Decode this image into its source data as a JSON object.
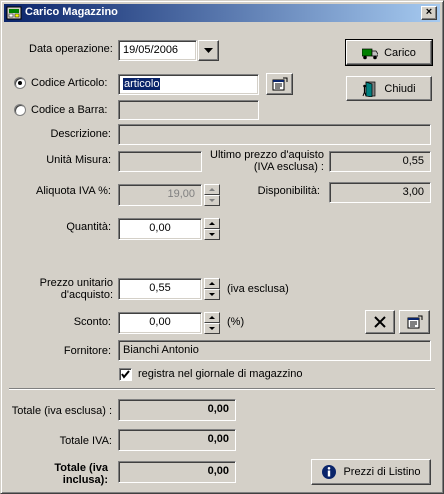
{
  "window": {
    "title": "Carico Magazzino",
    "close_label": "×"
  },
  "fields": {
    "data_operazione": {
      "label": "Data operazione:",
      "value": "19/05/2006"
    },
    "codice_articolo": {
      "label": "Codice Articolo:",
      "value": "articolo",
      "selected": true
    },
    "codice_barra": {
      "label": "Codice a Barra:",
      "value": ""
    },
    "descrizione": {
      "label": "Descrizione:",
      "value": ""
    },
    "unita_misura": {
      "label": "Unità Misura:",
      "value": ""
    },
    "ultimo_prezzo": {
      "label": "Ultimo prezzo d'aquisto (IVA esclusa) :",
      "value": "0,55"
    },
    "aliquota_iva": {
      "label": "Aliquota IVA %:",
      "value": "19,00"
    },
    "disponibilita": {
      "label": "Disponibilità:",
      "value": "3,00"
    },
    "quantita": {
      "label": "Quantità:",
      "value": "0,00"
    },
    "prezzo_unitario": {
      "label": "Prezzo unitario d'acquisto:",
      "value": "0,55",
      "suffix": "(iva esclusa)"
    },
    "sconto": {
      "label": "Sconto:",
      "value": "0,00",
      "suffix": "(%)"
    },
    "fornitore": {
      "label": "Fornitore:",
      "value": "Bianchi Antonio"
    },
    "registra": {
      "label": "registra nel giornale di magazzino",
      "checked": true
    }
  },
  "buttons": {
    "carico": "Carico",
    "chiudi": "Chiudi",
    "prezzi_listino": "Prezzi di Listino"
  },
  "totals": {
    "totale_iva_esclusa": {
      "label": "Totale (iva esclusa) :",
      "value": "0,00"
    },
    "totale_iva": {
      "label": "Totale IVA:",
      "value": "0,00"
    },
    "totale_iva_inclusa": {
      "label": "Totale (iva inclusa):",
      "value": "0,00"
    }
  },
  "colors": {
    "titlebar_start": "#0a246a",
    "titlebar_end": "#a6caf0",
    "face": "#d4d0c8"
  }
}
